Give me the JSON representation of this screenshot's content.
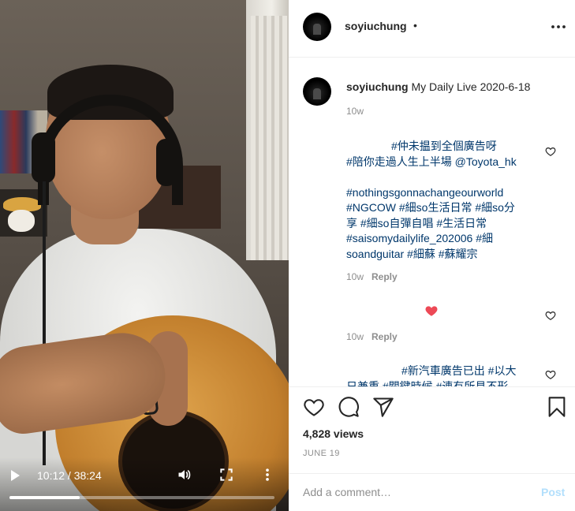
{
  "video": {
    "time_display": "10:12 / 38:24",
    "progress_fraction": 0.266,
    "icons": [
      "play-icon",
      "volume-icon",
      "fullscreen-icon",
      "more-vertical-icon"
    ]
  },
  "header": {
    "username": "soyiuchung",
    "dot": "•",
    "more_icon": "more-horizontal-icon"
  },
  "caption": {
    "username": "soyiuchung",
    "text": "My Daily Live 2020-6-18",
    "age": "10w"
  },
  "comments": [
    {
      "lines": [
        "#仲未揾到全個廣告呀",
        "#陪你走過人生上半場 @Toyota_hk",
        "",
        "#nothingsgonnachangeourworld",
        "#NGCOW #細so生活日常 #細so分",
        "享 #細so自彈自唱 #生活日常",
        "#saisomydailylife_202006 #細",
        "soandguitar #細蘇 #蘇耀宗"
      ],
      "age": "10w",
      "reply": "Reply"
    },
    {
      "lines": [],
      "age": "10w",
      "reply": "Reply",
      "heart_color": "#ed4956"
    },
    {
      "lines": [
        "#新汽車廣告已出 #以大",
        "日兼重 #關鍵時候 #連有所見不形"
      ]
    }
  ],
  "stats": {
    "views": "4,828 views",
    "date": "JUNE 19"
  },
  "add_comment": {
    "placeholder": "Add a comment…",
    "post_label": "Post"
  },
  "colors": {
    "link": "#00376b",
    "muted": "#8e8e8e",
    "post_disabled": "#b2dffc",
    "heart": "#ed4956"
  }
}
